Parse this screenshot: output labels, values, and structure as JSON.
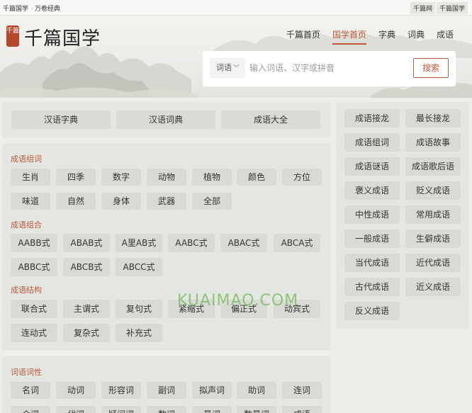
{
  "topbar": {
    "left": [
      "千篇国学",
      "万卷经典"
    ],
    "right": [
      "千篇网",
      "千篇国学"
    ]
  },
  "logo": {
    "seal": "千篇",
    "title": "千篇国学"
  },
  "nav": {
    "items": [
      {
        "label": "千篇首页",
        "active": false
      },
      {
        "label": "国学首页",
        "active": true
      },
      {
        "label": "字典",
        "active": false
      },
      {
        "label": "词典",
        "active": false
      },
      {
        "label": "成语",
        "active": false
      }
    ]
  },
  "search": {
    "type_label": "词语",
    "placeholder": "输入词语、汉字或拼音",
    "button": "搜索"
  },
  "top_links": [
    "汉语字典",
    "汉语词典",
    "成语大全"
  ],
  "sections": [
    {
      "title": "成语组词",
      "rows": [
        [
          "生肖",
          "四季",
          "数字",
          "动物",
          "植物",
          "颜色",
          "方位"
        ],
        [
          "味道",
          "自然",
          "身体",
          "武器",
          "全部"
        ]
      ]
    },
    {
      "title": "成语组合",
      "rows": [
        [
          "AABB式",
          "ABAB式",
          "A里AB式",
          "AABC式",
          "ABAC式",
          "ABCA式"
        ],
        [
          "ABBC式",
          "ABCB式",
          "ABCC式"
        ]
      ]
    },
    {
      "title": "成语结构",
      "rows": [
        [
          "联合式",
          "主谓式",
          "复句式",
          "紧缩式",
          "偏正式",
          "动宾式"
        ],
        [
          "连动式",
          "复杂式",
          "补充式"
        ]
      ]
    }
  ],
  "section2": {
    "title": "词语词性",
    "rows": [
      [
        "名词",
        "动词",
        "形容词",
        "副词",
        "拟声词",
        "助词",
        "连词"
      ],
      [
        "介词",
        "代词",
        "疑问词",
        "数词",
        "量词",
        "数量词",
        "成语"
      ]
    ]
  },
  "side_links": [
    [
      "成语接龙",
      "最长接龙"
    ],
    [
      "成语组词",
      "成语故事"
    ],
    [
      "成语谜语",
      "成语歌后语"
    ],
    [
      "褒义成语",
      "贬义成语"
    ],
    [
      "中性成语",
      "常用成语"
    ],
    [
      "一般成语",
      "生僻成语"
    ],
    [
      "当代成语",
      "近代成语"
    ],
    [
      "古代成语",
      "近义成语"
    ],
    [
      "反义成语"
    ]
  ],
  "watermark": "KUAIMAO.COM",
  "colors": {
    "accent": "#c0583b",
    "background": "#eceee9",
    "panel": "#e4e6e1",
    "chip": "#d8dbd5"
  }
}
